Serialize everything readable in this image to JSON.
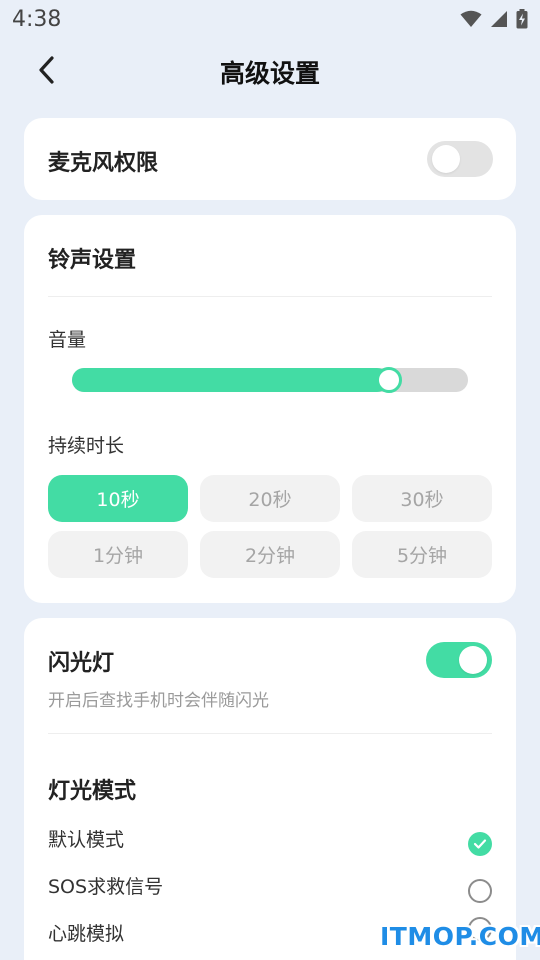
{
  "status_bar": {
    "time": "4:38",
    "icons": [
      "wifi-icon",
      "signal-icon",
      "battery-charging-icon"
    ]
  },
  "header": {
    "title": "高级设置",
    "back_icon": "chevron-left-icon"
  },
  "microphone": {
    "label": "麦克风权限",
    "enabled": false
  },
  "ringtone": {
    "section_title": "铃声设置",
    "volume_label": "音量",
    "volume_level": 0.8,
    "duration_label": "持续时长",
    "duration_options": [
      "10秒",
      "20秒",
      "30秒",
      "1分钟",
      "2分钟",
      "5分钟"
    ],
    "selected_duration": "10秒"
  },
  "flashlight": {
    "label": "闪光灯",
    "description": "开启后查找手机时会伴随闪光",
    "enabled": true,
    "mode_title": "灯光模式",
    "modes": [
      {
        "label": "默认模式",
        "selected": true
      },
      {
        "label": "SOS求救信号",
        "selected": false
      },
      {
        "label": "心跳模拟",
        "selected": false
      }
    ]
  },
  "watermark": "ITMOP.COM",
  "colors": {
    "accent": "#43dca4",
    "background": "#e9eff8",
    "watermark": "#1f8de6"
  }
}
